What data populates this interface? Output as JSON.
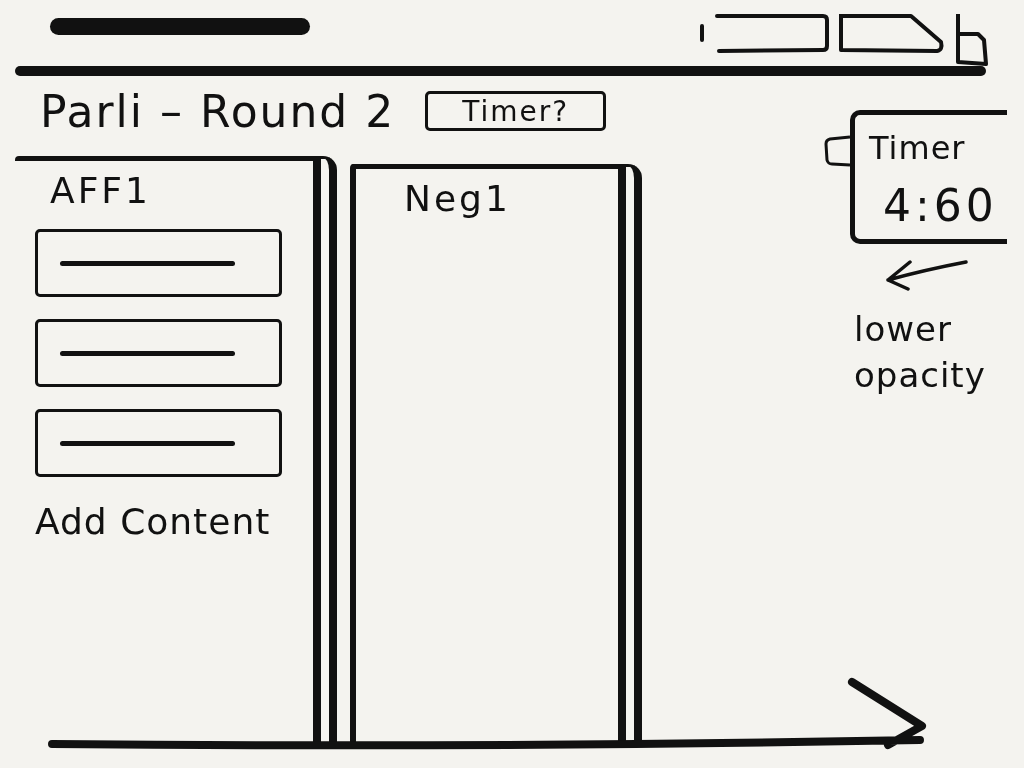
{
  "toolbar": [
    {
      "kind": "rect"
    },
    {
      "kind": "tab"
    },
    {
      "kind": "small-tab"
    }
  ],
  "title": "Parli – Round 2",
  "timer_button": "Timer?",
  "columns": [
    {
      "heading": "AFF1",
      "cards": [
        {
          "kind": "line"
        },
        {
          "kind": "line"
        },
        {
          "kind": "line"
        }
      ],
      "add_link": "Add Content"
    },
    {
      "heading": "Neg1"
    }
  ],
  "timer_widget": {
    "label": "Timer",
    "time": "4:60"
  },
  "note": "lower opacity"
}
